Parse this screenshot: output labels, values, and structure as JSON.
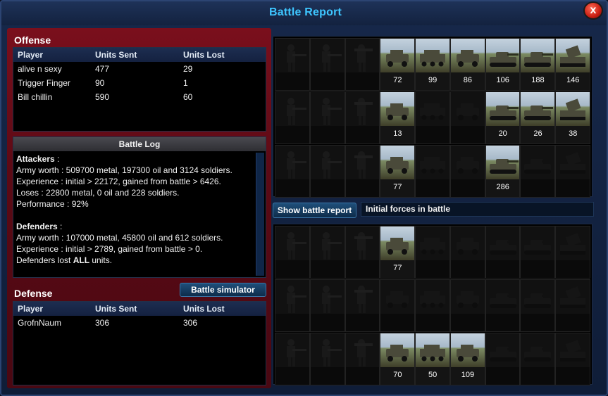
{
  "window": {
    "title": "Battle Report",
    "close_label": "x"
  },
  "offense": {
    "title": "Offense",
    "columns": [
      "Player",
      "Units Sent",
      "Units Lost"
    ],
    "rows": [
      [
        "alive n sexy",
        "477",
        "29"
      ],
      [
        "Trigger Finger",
        "90",
        "1"
      ],
      [
        "Bill chillin",
        "590",
        "60"
      ]
    ]
  },
  "battle_log": {
    "title": "Battle Log",
    "attackers_label": "Attackers",
    "attackers_lines": [
      "Army worth : 509700 metal, 197300 oil and 3124 soldiers.",
      "Experience : initial > 22172, gained from battle > 6426.",
      "Loses : 22800 metal, 0 oil and 228 soldiers.",
      "Performance : 92%"
    ],
    "defenders_label": "Defenders",
    "defenders_lines": [
      "Army worth : 107000 metal, 45800 oil and 612 soldiers.",
      "Experience : initial > 2789, gained from battle > 0."
    ],
    "defenders_lost_prefix": "Defenders lost ",
    "defenders_lost_bold": "ALL",
    "defenders_lost_suffix": " units."
  },
  "simulator_button": "Battle simulator",
  "defense": {
    "title": "Defense",
    "columns": [
      "Player",
      "Units Sent",
      "Units Lost"
    ],
    "rows": [
      [
        "GrofnNaum",
        "306",
        "306"
      ]
    ]
  },
  "show_report_button": "Show battle report",
  "info_text": "Initial forces in battle",
  "unit_icons": [
    "rifleman-icon",
    "sniper-icon",
    "rocket-soldier-icon",
    "jeep-icon",
    "apc-icon",
    "anti-air-icon",
    "light-tank-icon",
    "heavy-tank-icon",
    "artillery-icon"
  ],
  "attacker_grid": [
    [
      null,
      null,
      null,
      "72",
      "99",
      "86",
      "106",
      "188",
      "146"
    ],
    [
      null,
      null,
      null,
      "13",
      null,
      null,
      "20",
      "26",
      "38"
    ],
    [
      null,
      null,
      null,
      "77",
      null,
      null,
      "286",
      null,
      null
    ]
  ],
  "defender_grid": [
    [
      null,
      null,
      null,
      "77",
      null,
      null,
      null,
      null,
      null
    ],
    [
      null,
      null,
      null,
      null,
      null,
      null,
      null,
      null,
      null
    ],
    [
      null,
      null,
      null,
      "70",
      "50",
      "109",
      null,
      null,
      null
    ]
  ]
}
